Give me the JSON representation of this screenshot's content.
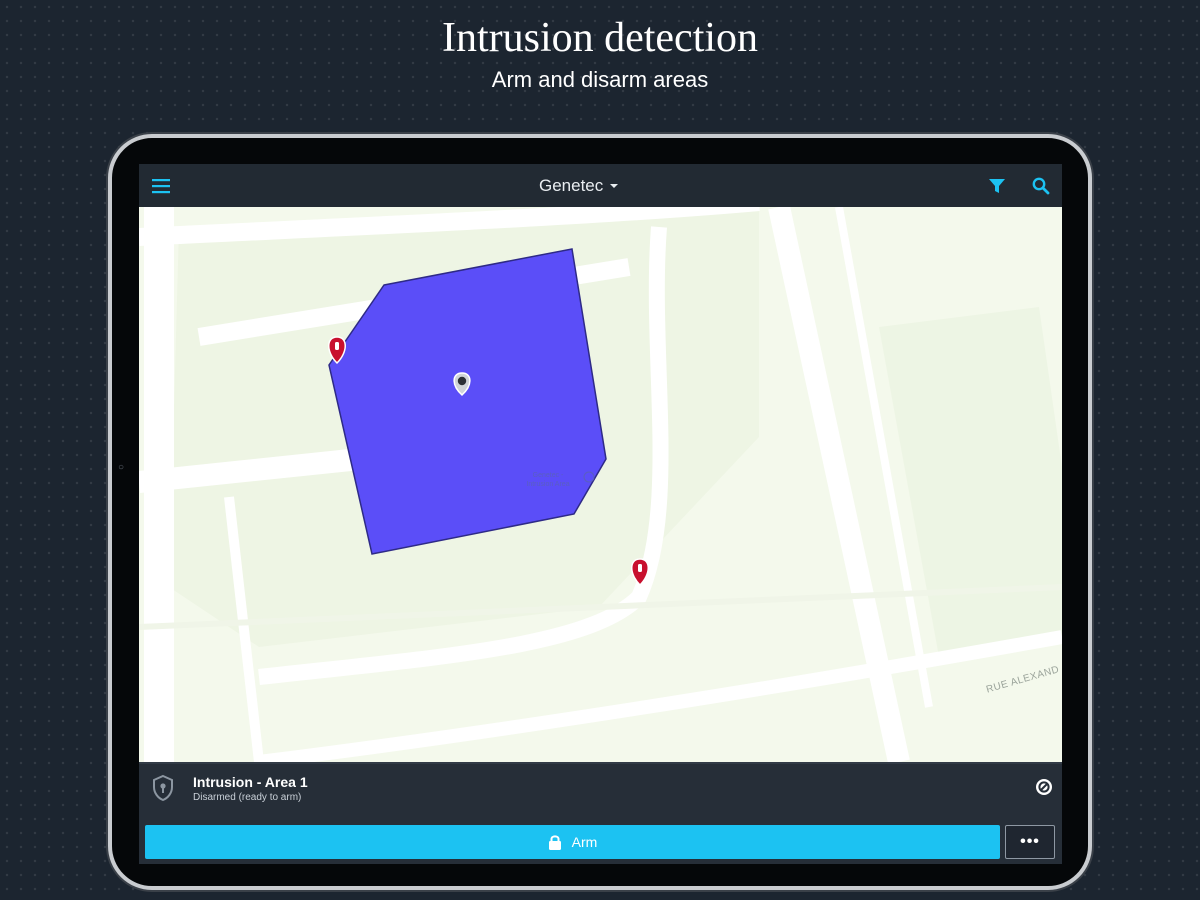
{
  "promo": {
    "title": "Intrusion detection",
    "subtitle": "Arm and disarm areas"
  },
  "header": {
    "title": "Genetec",
    "icons": [
      "menu-icon",
      "chevron-down-icon",
      "filter-icon",
      "search-icon"
    ]
  },
  "map": {
    "street_label": "RUE ALEXAND",
    "area_fill_color": "#5b4ef8",
    "pin_color": "#c8102e",
    "area_label": "Genetec - Intrusion Area"
  },
  "area_panel": {
    "name": "Intrusion - Area 1",
    "status": "Disarmed (ready to arm)",
    "arm_label": "Arm",
    "more_label": "•••",
    "accent_color": "#1cc2f2"
  }
}
